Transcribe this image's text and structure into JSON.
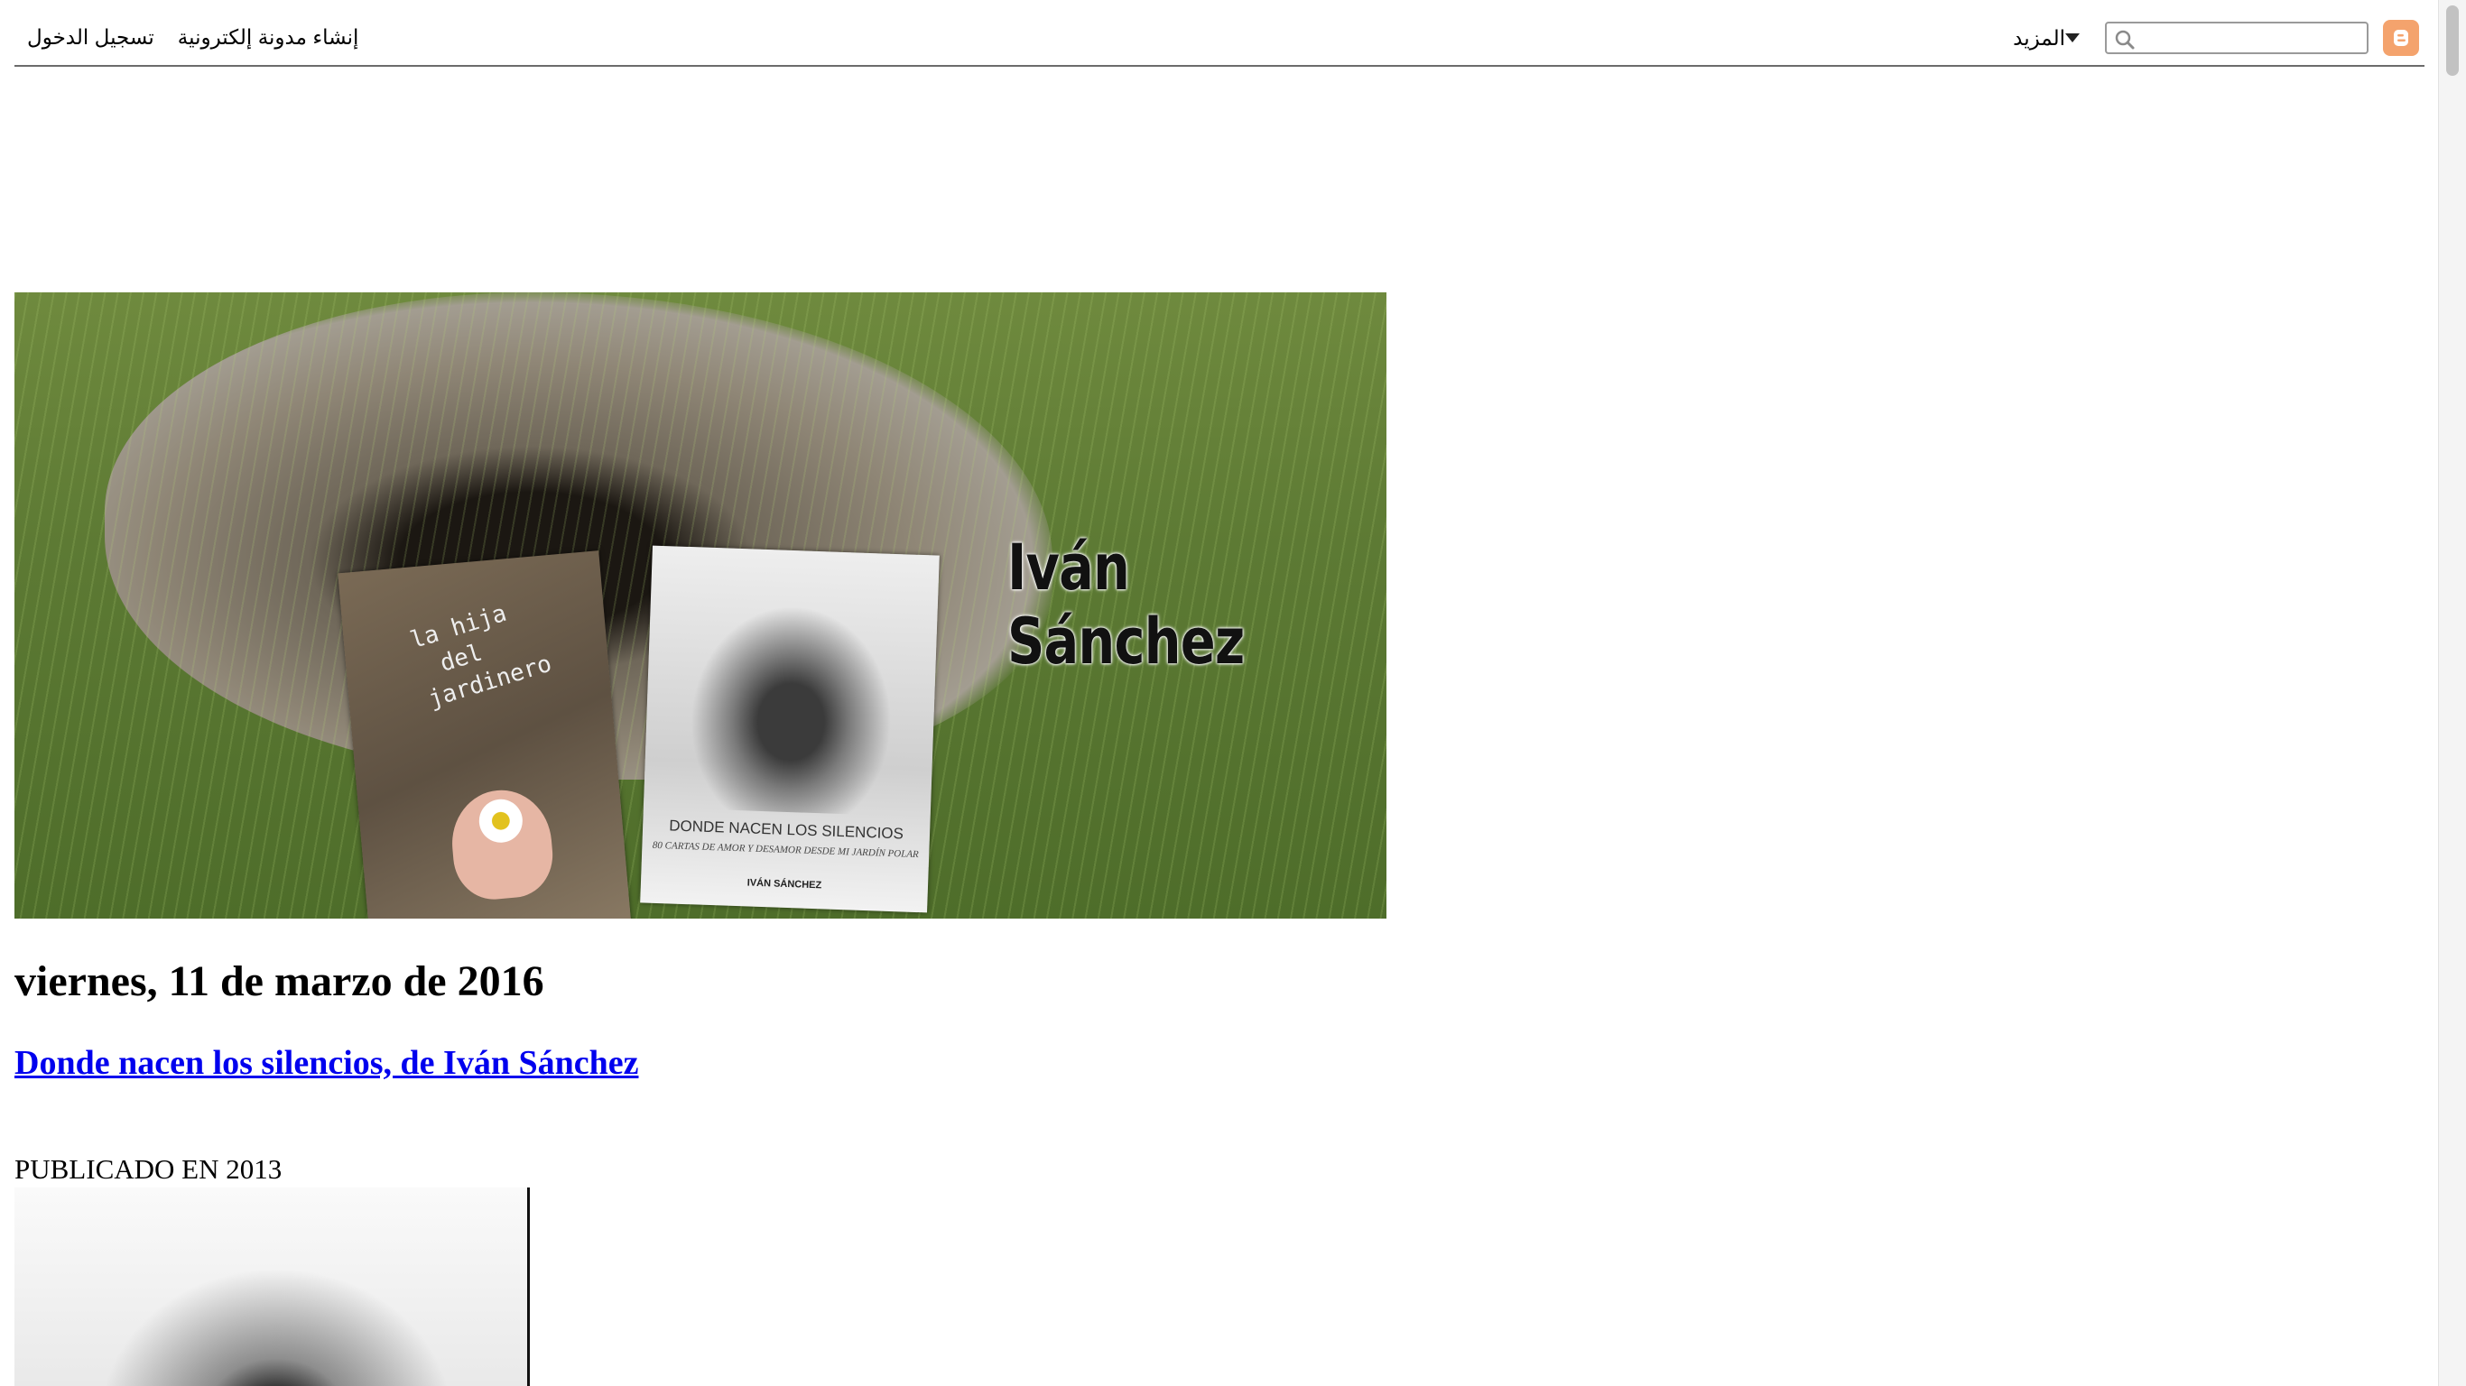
{
  "navbar": {
    "sign_in": "تسجيل الدخول",
    "create_blog": "إنشاء مدونة إلكترونية",
    "more": "المزيد",
    "search_value": "",
    "search_placeholder": ""
  },
  "header": {
    "brand_name": "Iván Sánchez",
    "book1_title_lines": [
      "la hija",
      "del",
      "jardinero"
    ],
    "book2_title": "DONDE NACEN LOS SILENCIOS",
    "book2_subtitle": "80 CARTAS DE AMOR Y DESAMOR DESDE MI JARDÍN POLAR",
    "book2_author": "IVÁN SÁNCHEZ"
  },
  "post": {
    "date": "viernes, 11 de marzo de 2016",
    "title": "Donde nacen los silencios, de Iván Sánchez",
    "published": "PUBLICADO EN 2013"
  },
  "colors": {
    "link": "#0000ee",
    "blogger_orange": "#f4a36d"
  },
  "icons": [
    "search-icon",
    "blogger-icon",
    "caret-down-icon"
  ]
}
